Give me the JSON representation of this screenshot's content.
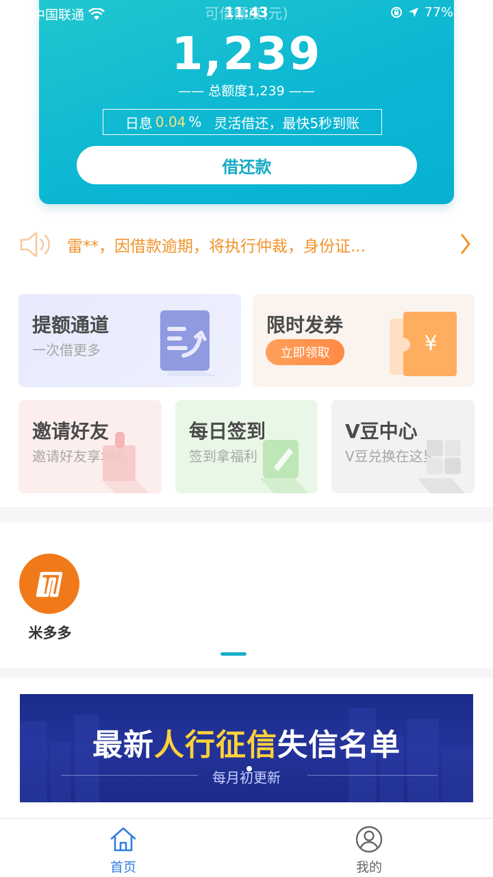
{
  "status_bar": {
    "carrier": "中国联通",
    "time": "11:43",
    "title_behind": "可借额度(元)",
    "battery": "77%"
  },
  "hero": {
    "amount": "1,239",
    "total_label": "—— 总额度1,239 ——",
    "rate_prefix": "日息",
    "rate_value": "0.04",
    "rate_suffix": "%",
    "rate_tagline": "灵活借还，最快5秒到账",
    "borrow_button": "借还款"
  },
  "notice": {
    "text": "雷**，因借款逾期，将执行仲裁，身份证..."
  },
  "tiles": {
    "limit": {
      "title": "提额通道",
      "subtitle": "一次借更多"
    },
    "coupon": {
      "title": "限时发券",
      "button": "立即领取",
      "icon_glyph": "¥"
    },
    "invite": {
      "title": "邀请好友",
      "subtitle": "邀请好友享壕礼"
    },
    "sign": {
      "title": "每日签到",
      "subtitle": "签到拿福利"
    },
    "vbean": {
      "title": "V豆中心",
      "subtitle": "V豆兑换在这里"
    }
  },
  "apps": [
    {
      "label": "米多多"
    }
  ],
  "banner": {
    "title_part1": "最新",
    "title_highlight": "人行征信",
    "title_part2": "失信名单",
    "subtitle": "每月初更新"
  },
  "tabbar": {
    "home": "首页",
    "mine": "我的"
  },
  "colors": {
    "primary": "#13a9c4",
    "notice": "#f0932b",
    "tab_active": "#2f7de1",
    "tab_inactive": "#666666"
  }
}
